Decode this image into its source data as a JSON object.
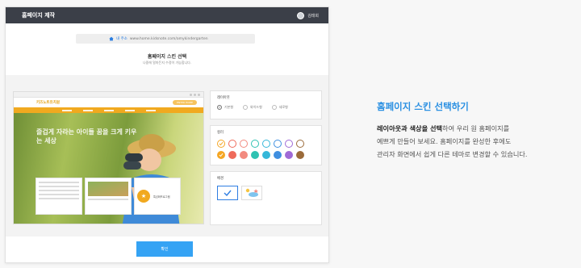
{
  "app": {
    "title": "홈페이지 제작",
    "user_name": "김태희"
  },
  "url_bar": {
    "label": "내 주소",
    "url": "www.home.kidsnote.com/amykindergarten"
  },
  "skin": {
    "title": "홈페이지 스킨 선택",
    "subtitle": "나중에 얼마든지 수정이 가능합니다."
  },
  "preview": {
    "logo": "키즈노트유치원",
    "header_button": "ENTER HOME",
    "hero_text": "즐겁게 자라는 아이들 꿈을 크게 키우는 세상",
    "badge_icon": "badge-icon",
    "badge_text": "특성화프로그램"
  },
  "layout_panel": {
    "label": "레이아웃",
    "options": [
      {
        "label": "기본형",
        "selected": true
      },
      {
        "label": "와이드형",
        "selected": false
      },
      {
        "label": "세로형",
        "selected": false
      }
    ]
  },
  "color_panel": {
    "label": "컬러",
    "colors": [
      {
        "hex": "#f5a623",
        "selected": true
      },
      {
        "hex": "#ef6b5b",
        "selected": false
      },
      {
        "hex": "#f28a7f",
        "selected": false
      },
      {
        "hex": "#2ec2b2",
        "selected": false
      },
      {
        "hex": "#35b7d9",
        "selected": false
      },
      {
        "hex": "#3f8fe0",
        "selected": false
      },
      {
        "hex": "#a06ad6",
        "selected": false
      },
      {
        "hex": "#9b6b3a",
        "selected": false
      }
    ]
  },
  "background_panel": {
    "label": "배경",
    "options": [
      {
        "name": "plain-background-option",
        "selected": true
      },
      {
        "name": "sky-background-option",
        "selected": false
      }
    ]
  },
  "confirm_label": "확인",
  "side": {
    "title": "홈페이지 스킨 선택하기",
    "desc_bold": "레이아웃과 색상을 선택",
    "desc_1": "하여 우리 원 홈페이지를",
    "desc_2": "예쁘게 만들어 보세요. 홈페이지를 완성한 후에도",
    "desc_3": "관리자 화면에서 쉽게 다른 테마로 변경할 수 있습니다."
  },
  "colors": {
    "accent": "#35a3f4",
    "topbar": "#3b3f48",
    "theme_orange": "#f1a91f",
    "title_blue": "#2b90e2"
  }
}
